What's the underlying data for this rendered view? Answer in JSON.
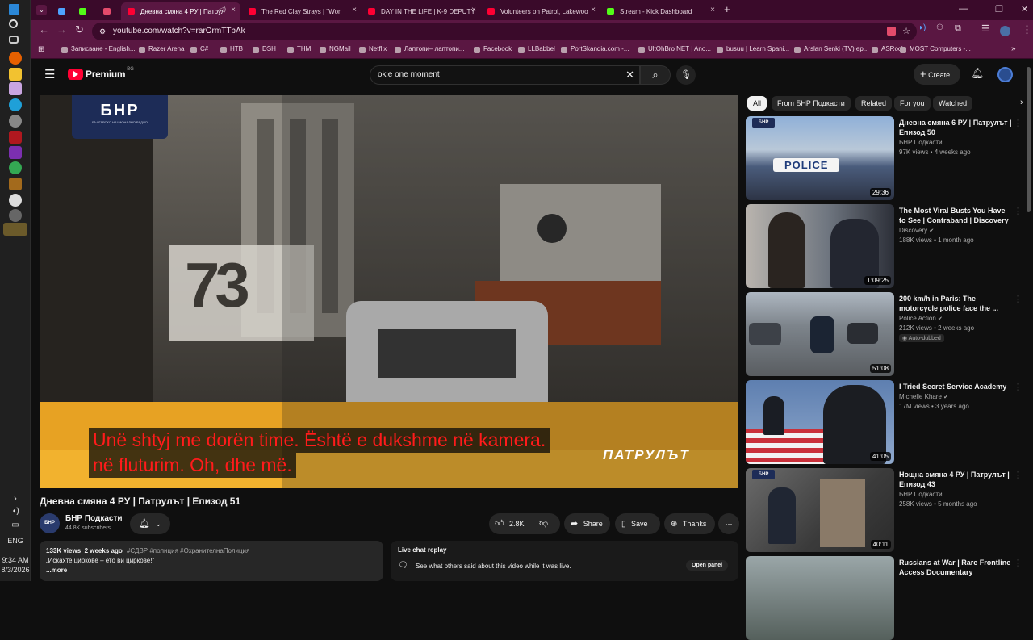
{
  "taskbar": {
    "time": "9:34 AM",
    "date": "8/3/2026",
    "lang": "ENG"
  },
  "browser": {
    "tabs": [
      {
        "label": "",
        "fav": "#4da3ff"
      },
      {
        "label": "",
        "fav": "#53fc18"
      },
      {
        "label": "",
        "fav": "#e34b6b"
      },
      {
        "label": "Дневна смяна 4 РУ | Патрул",
        "fav": "#ff0033"
      },
      {
        "label": "The Red Clay Strays | \"Won",
        "fav": "#ff0033"
      },
      {
        "label": "DAY IN THE LIFE | K-9 DEPUTY",
        "fav": "#ff0033"
      },
      {
        "label": "Volunteers on Patrol, Lakewoo",
        "fav": "#ff0033"
      },
      {
        "label": "Stream - Kick Dashboard",
        "fav": "#53fc18"
      }
    ],
    "url": "youtube.com/watch?v=rarOrmTTbAk",
    "bookmarks": [
      "Записване - English...",
      "Razer Arena",
      "C#",
      "HTB",
      "DSH",
      "THM",
      "NGMail",
      "Netflix",
      "Лаптопи– лаптопи...",
      "Facebook",
      "LLBabbel",
      "PortSkandia.com -...",
      "UltOhBro NET | Ano...",
      "busuu | Learn Spani...",
      "Arslan Senki (TV) ep...",
      "ASRock",
      "MOST Computers -..."
    ]
  },
  "youtube": {
    "logo": "Premium",
    "logo_sup": "BG",
    "search_value": "okie one moment",
    "create_label": "Create",
    "video": {
      "channel_logo": "БНР",
      "channel_logo_sub": "БЪЛГАРСКО НАЦИОНАЛНО РАДИО",
      "bus_number": "73",
      "watermark": "ПАТРУЛЪТ",
      "caption_line1": "Unë shtyj me dorën time. Është e dukshme në kamera.",
      "caption_line2": "në fluturim. Oh, dhe më."
    },
    "title": "Дневна смяна 4 РУ | Патрулът | Епизод 51",
    "channel": "БНР Подкасти",
    "subscribers": "44.8K subscribers",
    "likes": "2.8K",
    "share_label": "Share",
    "save_label": "Save",
    "thanks_label": "Thanks",
    "desc": {
      "meta": "133K views  2 weeks ago",
      "tags": "#СДВР #полиция #ОхранителнаПолиция",
      "text": "„Искахте циркове – ето ви циркове!\"",
      "more": "...more"
    },
    "chat": {
      "title": "Live chat replay",
      "text": "See what others said about this video while it was live.",
      "button": "Open panel"
    },
    "chips": [
      "All",
      "From БНР Подкасти",
      "Related",
      "For you",
      "Watched"
    ],
    "recs": [
      {
        "title": "Дневна смяна 6 РУ | Патрулът | Епизод 50",
        "channel": "БНР Подкасти",
        "meta": "97K views • 4 weeks ago",
        "dur": "29:36",
        "thumb_text": "POLICE",
        "badge": ""
      },
      {
        "title": "The Most Viral Busts You Have to See | Contraband | Discovery",
        "channel": "Discovery",
        "meta": "188K views • 1 month ago",
        "dur": "1:09:25",
        "thumb_text": "",
        "badge": ""
      },
      {
        "title": "200 km/h in Paris: The motorcycle police face the ...",
        "channel": "Police Action",
        "meta": "212K views • 2 weeks ago",
        "dur": "51:08",
        "thumb_text": "",
        "badge": "Auto-dubbed"
      },
      {
        "title": "I Tried Secret Service Academy",
        "channel": "Michelle Khare",
        "meta": "17M views • 3 years ago",
        "dur": "41:05",
        "thumb_text": "",
        "badge": ""
      },
      {
        "title": "Нощна смяна 4 РУ | Патрулът | Епизод 43",
        "channel": "БНР Подкасти",
        "meta": "258K views • 5 months ago",
        "dur": "40:11",
        "thumb_text": "",
        "badge": ""
      },
      {
        "title": "Russians at War | Rare Frontline Access Documentary",
        "channel": "",
        "meta": "",
        "dur": "",
        "thumb_text": "",
        "badge": ""
      }
    ]
  }
}
